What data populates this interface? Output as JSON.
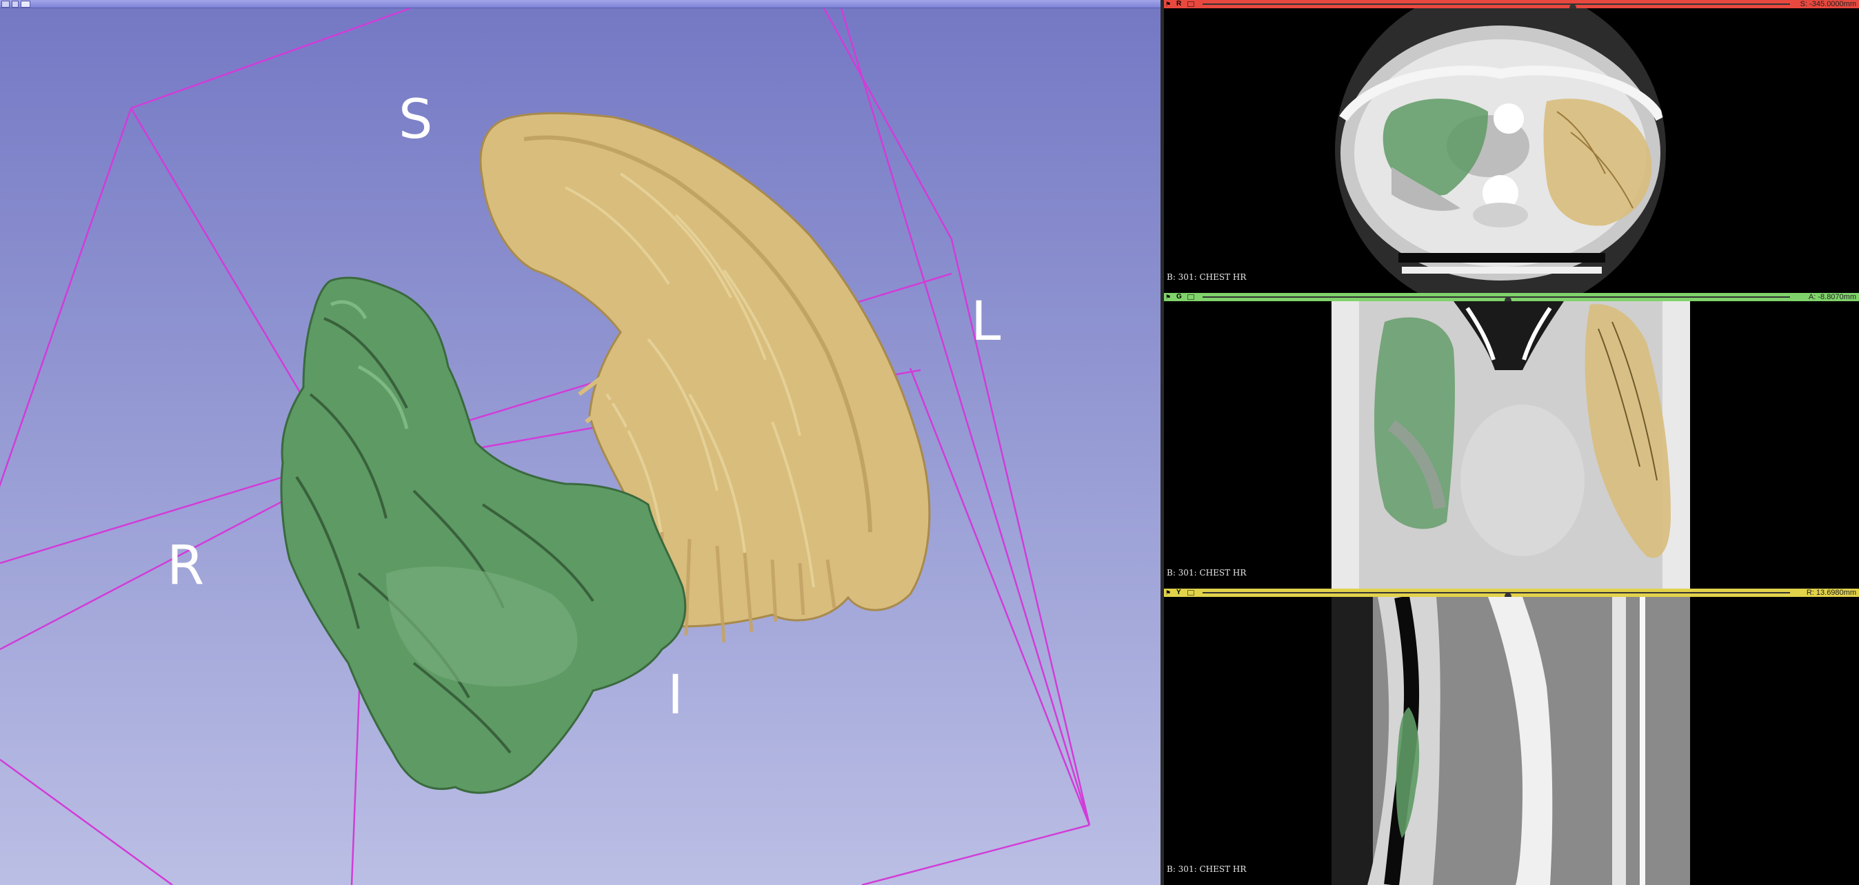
{
  "view3d": {
    "orientation_labels": {
      "superior": "S",
      "inferior": "I",
      "right": "R",
      "left": "L"
    },
    "segments": [
      {
        "name": "right-lung",
        "color": "#5e9a64"
      },
      {
        "name": "left-lung",
        "color": "#d8bd7c"
      }
    ],
    "bounding_box_color": "#d23cd8",
    "background_top": "#7478c4",
    "background_bottom": "#bbbee4"
  },
  "slices": [
    {
      "id": "red",
      "letter": "R",
      "bar_color": "#e8483e",
      "offset": "S: -345.0000mm",
      "slider_fraction": 0.63,
      "volume_label": "B: 301: CHEST HR"
    },
    {
      "id": "green",
      "letter": "G",
      "bar_color": "#7fd36a",
      "offset": "A: -8.8070mm",
      "slider_fraction": 0.52,
      "volume_label": "B: 301: CHEST HR"
    },
    {
      "id": "yellow",
      "letter": "Y",
      "bar_color": "#e2d24a",
      "offset": "R: 13.6980mm",
      "slider_fraction": 0.52,
      "volume_label": "B: 301: CHEST HR"
    }
  ]
}
